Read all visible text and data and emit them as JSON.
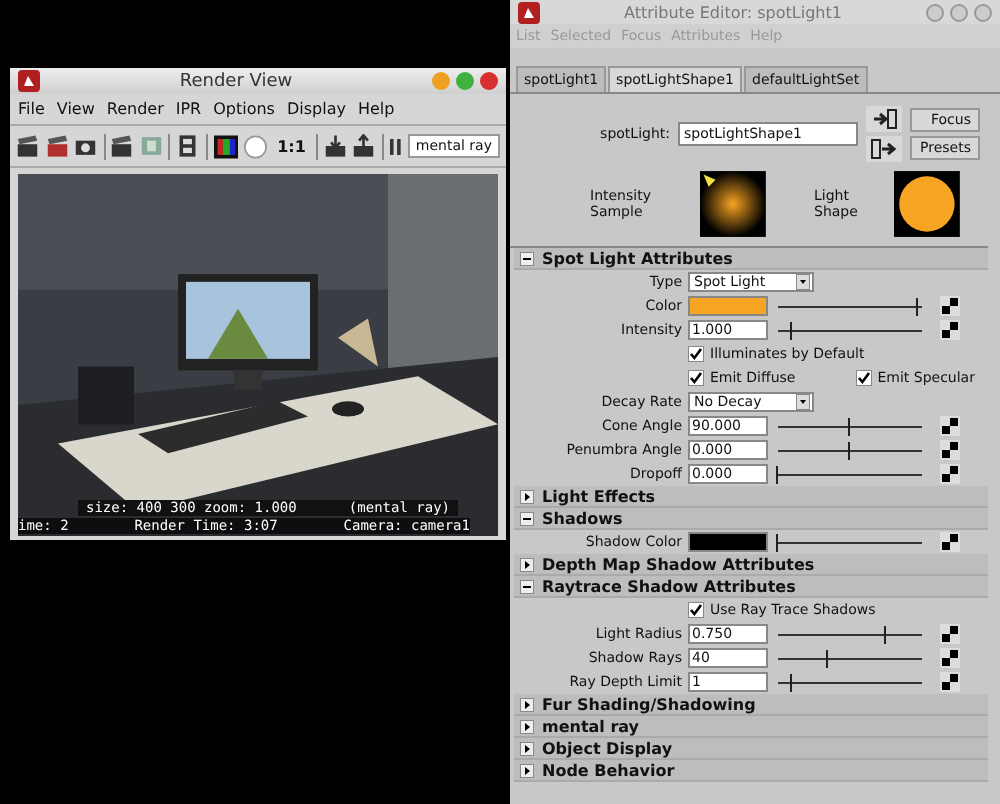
{
  "render_view": {
    "title": "Render View",
    "menu": [
      "File",
      "View",
      "Render",
      "IPR",
      "Options",
      "Display",
      "Help"
    ],
    "scale_label": "1:1",
    "renderer": "mental ray",
    "image": {
      "kind": "picture"
    },
    "info_line": [
      "size:  400  300 zoom: 1.000",
      "(mental ray)"
    ],
    "status_line": [
      "ime: 2",
      "Render Time:  3:07",
      "Camera: camera1"
    ]
  },
  "attribute_editor": {
    "title": "Attribute Editor: spotLight1",
    "menu": [
      "List",
      "Selected",
      "Focus",
      "Attributes",
      "Help"
    ],
    "tabs": [
      {
        "label": "spotLight1",
        "selected": false
      },
      {
        "label": "spotLightShape1",
        "selected": true
      },
      {
        "label": "defaultLightSet",
        "selected": false
      }
    ],
    "node_label": "spotLight:",
    "node_value": "spotLightShape1",
    "buttons": [
      "Focus",
      "Presets"
    ],
    "samples": [
      {
        "label": "Intensity Sample",
        "kind": "glow"
      },
      {
        "label": "Light Shape",
        "kind": "disc"
      }
    ],
    "sections": [
      {
        "title": "Spot Light Attributes",
        "expanded": true,
        "rows": [
          {
            "kind": "dropdown",
            "label": "Type",
            "value": "Spot Light"
          },
          {
            "kind": "color",
            "label": "Color",
            "color": "#f7a422",
            "level": 0.97
          },
          {
            "kind": "slider",
            "label": "Intensity",
            "value": "1.000",
            "level": 0.1
          },
          {
            "kind": "checks",
            "items": [
              {
                "label": "Illuminates by Default",
                "checked": true
              }
            ]
          },
          {
            "kind": "checks",
            "items": [
              {
                "label": "Emit Diffuse",
                "checked": true
              },
              {
                "label": "Emit Specular",
                "checked": true
              }
            ]
          },
          {
            "kind": "dropdown",
            "label": "Decay Rate",
            "value": "No Decay"
          },
          {
            "kind": "slider",
            "label": "Cone Angle",
            "value": "90.000",
            "level": 0.5
          },
          {
            "kind": "slider",
            "label": "Penumbra Angle",
            "value": "0.000",
            "level": 0.5
          },
          {
            "kind": "slider",
            "label": "Dropoff",
            "value": "0.000",
            "level": 0.0
          }
        ]
      },
      {
        "title": "Light Effects",
        "expanded": false
      },
      {
        "title": "Shadows",
        "expanded": true,
        "rows": [
          {
            "kind": "color",
            "label": "Shadow Color",
            "color": "#000000",
            "level": 0.0
          }
        ]
      },
      {
        "title": "Depth Map Shadow Attributes",
        "expanded": false
      },
      {
        "title": "Raytrace Shadow Attributes",
        "expanded": true,
        "rows": [
          {
            "kind": "checks",
            "items": [
              {
                "label": "Use Ray Trace Shadows",
                "checked": true
              }
            ]
          },
          {
            "kind": "slider",
            "label": "Light Radius",
            "value": "0.750",
            "level": 0.75
          },
          {
            "kind": "slider",
            "label": "Shadow Rays",
            "value": "40",
            "level": 0.35
          },
          {
            "kind": "slider",
            "label": "Ray Depth Limit",
            "value": "1",
            "level": 0.1
          }
        ]
      },
      {
        "title": "Fur Shading/Shadowing",
        "expanded": false
      },
      {
        "title": "mental ray",
        "expanded": false
      },
      {
        "title": "Object Display",
        "expanded": false
      },
      {
        "title": "Node Behavior",
        "expanded": false
      }
    ]
  }
}
